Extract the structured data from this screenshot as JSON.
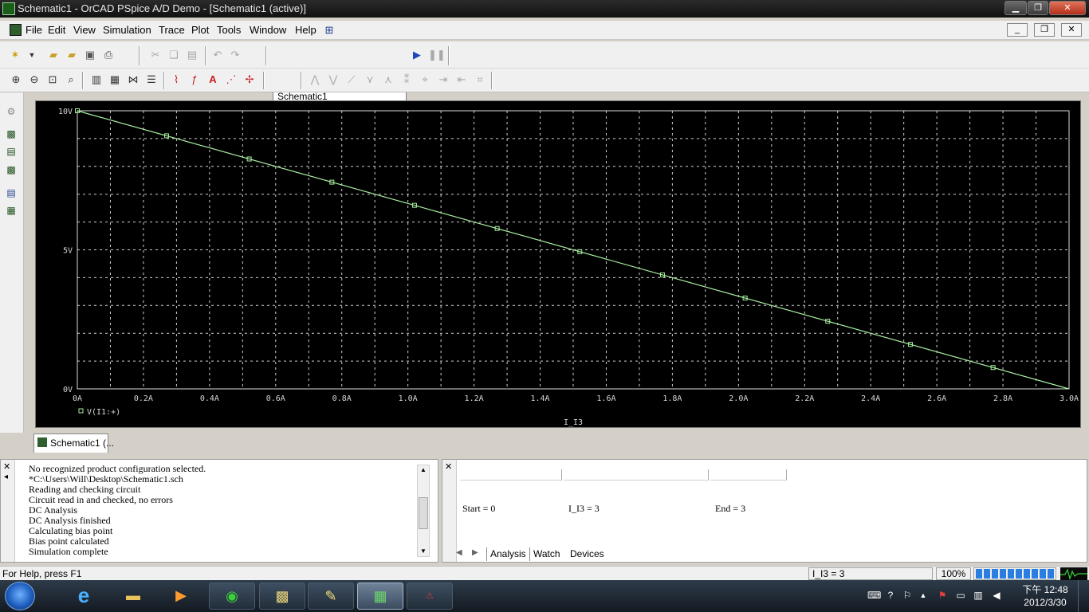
{
  "window": {
    "title": "Schematic1 - OrCAD PSpice A/D Demo - [Schematic1 (active)]"
  },
  "menu": [
    "File",
    "Edit",
    "View",
    "Simulation",
    "Trace",
    "Plot",
    "Tools",
    "Window",
    "Help"
  ],
  "toolbar": {
    "profile_name": "Schematic1"
  },
  "plot": {
    "legend": "V(I1:+)"
  },
  "chart_data": {
    "type": "line",
    "xlabel": "I_I3",
    "ylabel": "",
    "xlim": [
      0,
      3.0
    ],
    "ylim": [
      0,
      10
    ],
    "x_ticks": [
      "0A",
      "0.2A",
      "0.4A",
      "0.6A",
      "0.8A",
      "1.0A",
      "1.2A",
      "1.4A",
      "1.6A",
      "1.8A",
      "2.0A",
      "2.2A",
      "2.4A",
      "2.6A",
      "2.8A",
      "3.0A"
    ],
    "y_ticks": [
      "0V",
      "5V",
      "10V"
    ],
    "grid": true,
    "series": [
      {
        "name": "V(I1:+)",
        "color": "#a8f0a0",
        "x": [
          0,
          3.0
        ],
        "y": [
          10,
          0
        ],
        "marker_x": [
          0,
          0.27,
          0.52,
          0.77,
          1.02,
          1.27,
          1.52,
          1.77,
          2.02,
          2.27,
          2.52,
          2.77
        ]
      }
    ]
  },
  "doc_tab": "Schematic1 (...",
  "output_lines": [
    "No recognized product configuration selected.",
    "*C:\\Users\\Will\\Desktop\\Schematic1.sch",
    "Reading and checking circuit",
    "Circuit read in and checked, no errors",
    "DC Analysis",
    "DC Analysis finished",
    "Calculating bias point",
    "Bias point calculated",
    "Simulation complete"
  ],
  "probe": {
    "start": "Start = 0",
    "current": "I_I3 =  3",
    "end": "End = 3"
  },
  "panel_tabs": [
    "Analysis",
    "Watch",
    "Devices"
  ],
  "status": {
    "help": "For Help, press F1",
    "value": "I_I3 =  3",
    "zoom": "100%"
  },
  "clock": {
    "time": "下午 12:48",
    "date": "2012/3/30"
  }
}
